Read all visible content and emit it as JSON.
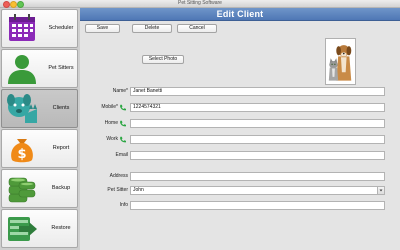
{
  "window": {
    "title": "Pet Sitting Software"
  },
  "sidebar": {
    "items": [
      {
        "label": "Scheduler",
        "icon": "calendar-icon"
      },
      {
        "label": "Pet Sitters",
        "icon": "person-icon"
      },
      {
        "label": "Clients",
        "icon": "pets-icon"
      },
      {
        "label": "Report",
        "icon": "money-bag-icon"
      },
      {
        "label": "Backup",
        "icon": "database-icon"
      },
      {
        "label": "Restore",
        "icon": "restore-arrow-icon"
      }
    ],
    "active": "Clients"
  },
  "header": {
    "title": "Edit Client"
  },
  "toolbar": {
    "save_label": "Save",
    "delete_label": "Delete",
    "cancel_label": "Cancel"
  },
  "photo": {
    "button_label": "Select Photo"
  },
  "form": {
    "name": {
      "label": "Name*",
      "value": "Janet Banetti"
    },
    "mobile": {
      "label": "Mobile*",
      "value": "1224574321"
    },
    "home": {
      "label": "Home",
      "value": ""
    },
    "work": {
      "label": "Work",
      "value": ""
    },
    "email": {
      "label": "Email",
      "value": ""
    },
    "address": {
      "label": "Address",
      "value": ""
    },
    "pet_sitter": {
      "label": "Pet Sitter",
      "value": "John"
    },
    "info": {
      "label": "Info",
      "value": ""
    }
  },
  "colors": {
    "header": "#5a82bf",
    "calendar": "#8c2bb8",
    "person": "#3a9a3a",
    "pets": "#36a7a4",
    "money": "#f08a18",
    "database": "#4f9a3a",
    "restore": "#3b9a4b",
    "phone": "#2aa642"
  }
}
